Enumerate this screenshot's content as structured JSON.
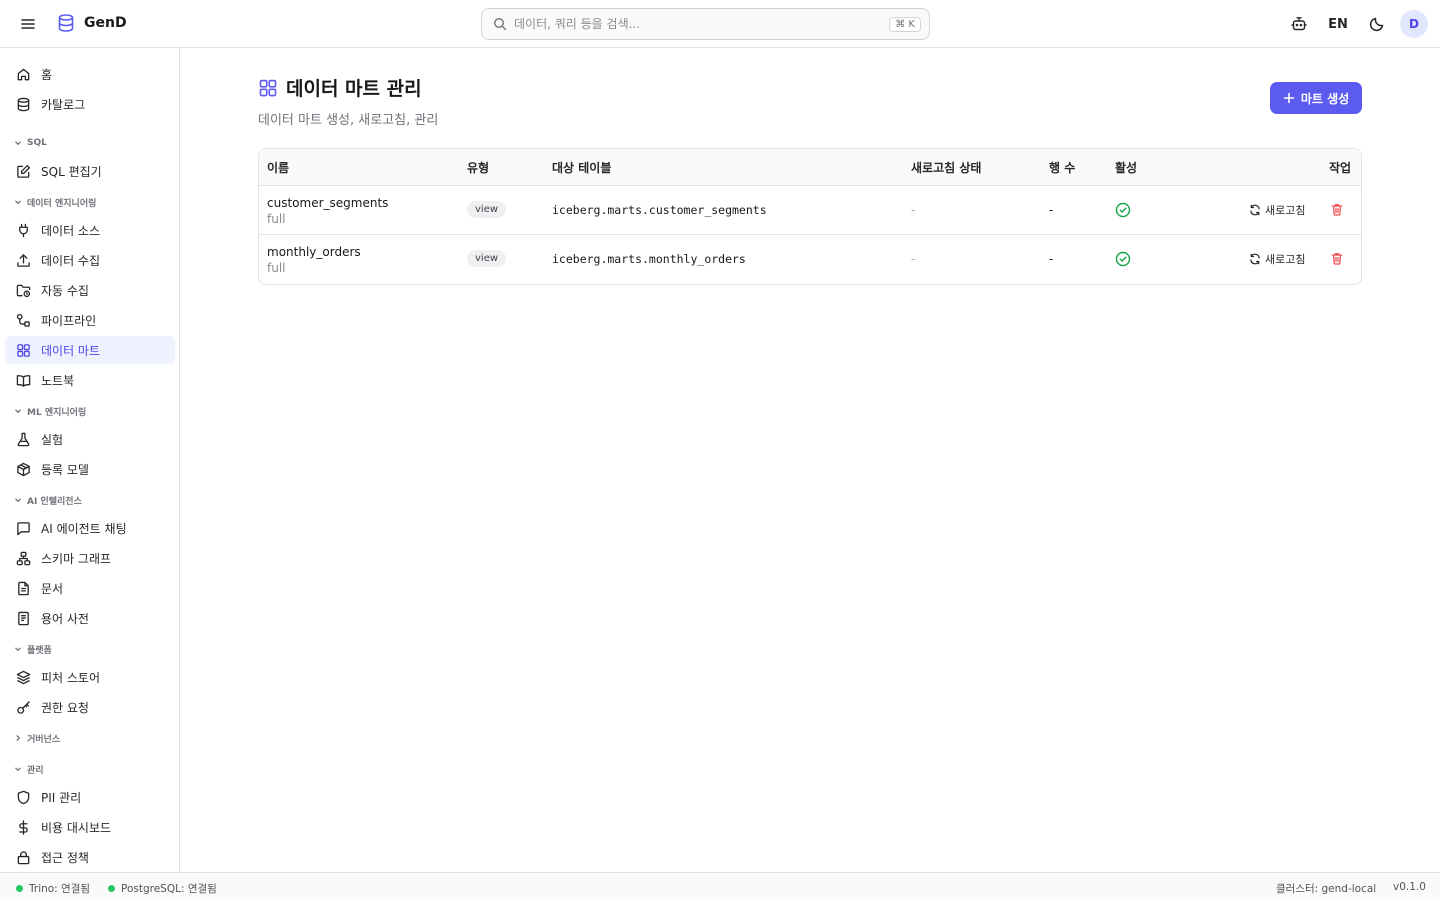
{
  "header": {
    "brand": "GenD",
    "search": {
      "placeholder": "데이터, 쿼리 등을 검색...",
      "shortcut": "⌘ K"
    },
    "language": "EN",
    "avatar_initial": "D"
  },
  "sidebar": {
    "home": "홈",
    "catalog": "카탈로그",
    "groups": {
      "sql": "SQL",
      "data_engineering": "데이터 엔지니어링",
      "ml_engineering": "ML 엔지니어링",
      "ai_intelligence": "AI 인텔리전스",
      "platform": "플랫폼",
      "governance": "거버넌스",
      "admin": "관리"
    },
    "items": {
      "sql_editor": "SQL 편집기",
      "data_source": "데이터 소스",
      "data_ingest": "데이터 수집",
      "auto_ingest": "자동 수집",
      "pipeline": "파이프라인",
      "data_mart": "데이터 마트",
      "notebook": "노트북",
      "experiment": "실험",
      "registered_model": "등록 모델",
      "ai_agent_chat": "AI 에이전트 채팅",
      "schema_graph": "스키마 그래프",
      "documents": "문서",
      "glossary": "용어 사전",
      "feature_store": "피처 스토어",
      "permission_request": "권한 요청",
      "pii_management": "PII 관리",
      "cost_dashboard": "비용 대시보드",
      "access_policy": "접근 정책"
    }
  },
  "page": {
    "title": "데이터 마트 관리",
    "subtitle": "데이터 마트 생성, 새로고침, 관리",
    "create_button": "마트 생성"
  },
  "table": {
    "columns": {
      "name": "이름",
      "type": "유형",
      "target": "대상 테이블",
      "refresh_status": "새로고침 상태",
      "row_count": "행 수",
      "active": "활성",
      "actions": "작업"
    },
    "refresh_label": "새로고침",
    "rows": [
      {
        "name": "customer_segments",
        "mode": "full",
        "type": "view",
        "target": "iceberg.marts.customer_segments",
        "refresh_status": "-",
        "row_count": "-",
        "active": true
      },
      {
        "name": "monthly_orders",
        "mode": "full",
        "type": "view",
        "target": "iceberg.marts.monthly_orders",
        "refresh_status": "-",
        "row_count": "-",
        "active": true
      }
    ]
  },
  "statusbar": {
    "trino": "Trino: 연결됨",
    "postgres": "PostgreSQL: 연결됨",
    "cluster": "클러스터: gend-local",
    "version": "v0.1.0"
  },
  "colors": {
    "accent": "#5b5bf0",
    "active_nav_bg": "#eef2ff",
    "success": "#16a34a",
    "danger": "#ef4444"
  }
}
